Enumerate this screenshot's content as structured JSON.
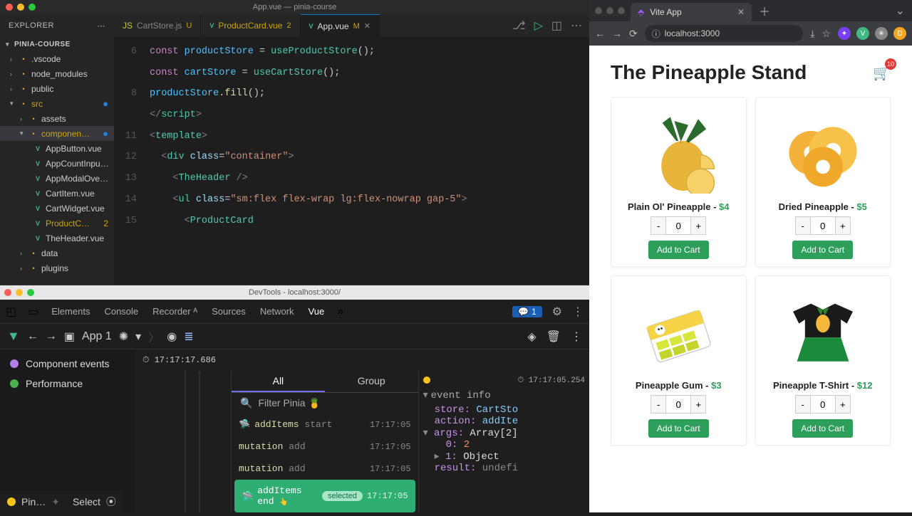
{
  "titlebar": "App.vue — pinia-course",
  "explorer": {
    "title": "EXPLORER",
    "project": "PINIA-COURSE"
  },
  "tree": {
    "vscode": ".vscode",
    "node_modules": "node_modules",
    "public": "public",
    "src": "src",
    "assets": "assets",
    "components": "componen…",
    "files": [
      "AppButton.vue",
      "AppCountInpu…",
      "AppModalOver…",
      "CartItem.vue",
      "CartWidget.vue",
      "ProductC…",
      "TheHeader.vue"
    ],
    "productBadge": "2",
    "data": "data",
    "plugins": "plugins"
  },
  "tabs": {
    "cart": "CartStore.js",
    "cartStatus": "U",
    "product": "ProductCard.vue",
    "productBadge": "2",
    "app": "App.vue",
    "appStatus": "M"
  },
  "code": {
    "l6a": "const",
    "l6b": "productStore",
    "l6c": "useProductStore",
    "l7a": "const",
    "l7b": "cartStore",
    "l7c": "useCartStore",
    "l8a": "productStore",
    "l8b": "fill",
    "l9": "script",
    "l11": "template",
    "l12t": "div",
    "l12a": "class",
    "l12v": "\"container\"",
    "l13": "TheHeader",
    "l14t": "ul",
    "l14a": "class",
    "l14v": "\"sm:flex flex-wrap lg:flex-nowrap gap-5\"",
    "l15": "ProductCard",
    "gutters": [
      "6",
      "",
      "8",
      "",
      "",
      "",
      "11",
      "",
      "12",
      "",
      "13",
      "",
      "14",
      "",
      "15"
    ]
  },
  "devtools": {
    "title": "DevTools - localhost:3000/",
    "tabs": [
      "Elements",
      "Console",
      "Recorder",
      "Sources",
      "Network",
      "Vue"
    ],
    "msgCount": "1",
    "app": "App 1",
    "leftRows": [
      "Component events",
      "Performance"
    ],
    "bottomLabel": "Pin…",
    "select": "Select",
    "tsLeft": "17:17:17.686",
    "tsRight": "17:17:05.254",
    "evTabs": [
      "All",
      "Group"
    ],
    "filterPlaceholder": "Filter Pinia 🍍",
    "events": [
      {
        "name": "addItems",
        "sub": "start",
        "time": "17:17:05"
      },
      {
        "name": "mutation",
        "sub": "add",
        "time": "17:17:05"
      },
      {
        "name": "mutation",
        "sub": "add",
        "time": "17:17:05"
      },
      {
        "name": "addItems",
        "sub": "end",
        "time": "17:17:05",
        "selected": true
      }
    ],
    "selectedLabel": "selected",
    "info": {
      "head": "event info",
      "store": "CartSto",
      "action": "addIte",
      "args": "Array[2]",
      "arg0": "2",
      "arg1": "Object",
      "result": "undefi"
    }
  },
  "browser": {
    "tabName": "Vite App",
    "url": "localhost:3000"
  },
  "page": {
    "title": "The Pineapple Stand",
    "cartCount": "10",
    "products": [
      {
        "name": "Plain Ol' Pineapple",
        "price": "$4",
        "qty": "0"
      },
      {
        "name": "Dried Pineapple",
        "price": "$5",
        "qty": "0"
      },
      {
        "name": "Pineapple Gum",
        "price": "$3",
        "qty": "0"
      },
      {
        "name": "Pineapple T-Shirt",
        "price": "$12",
        "qty": "0"
      }
    ],
    "addLabel": "Add to Cart"
  }
}
